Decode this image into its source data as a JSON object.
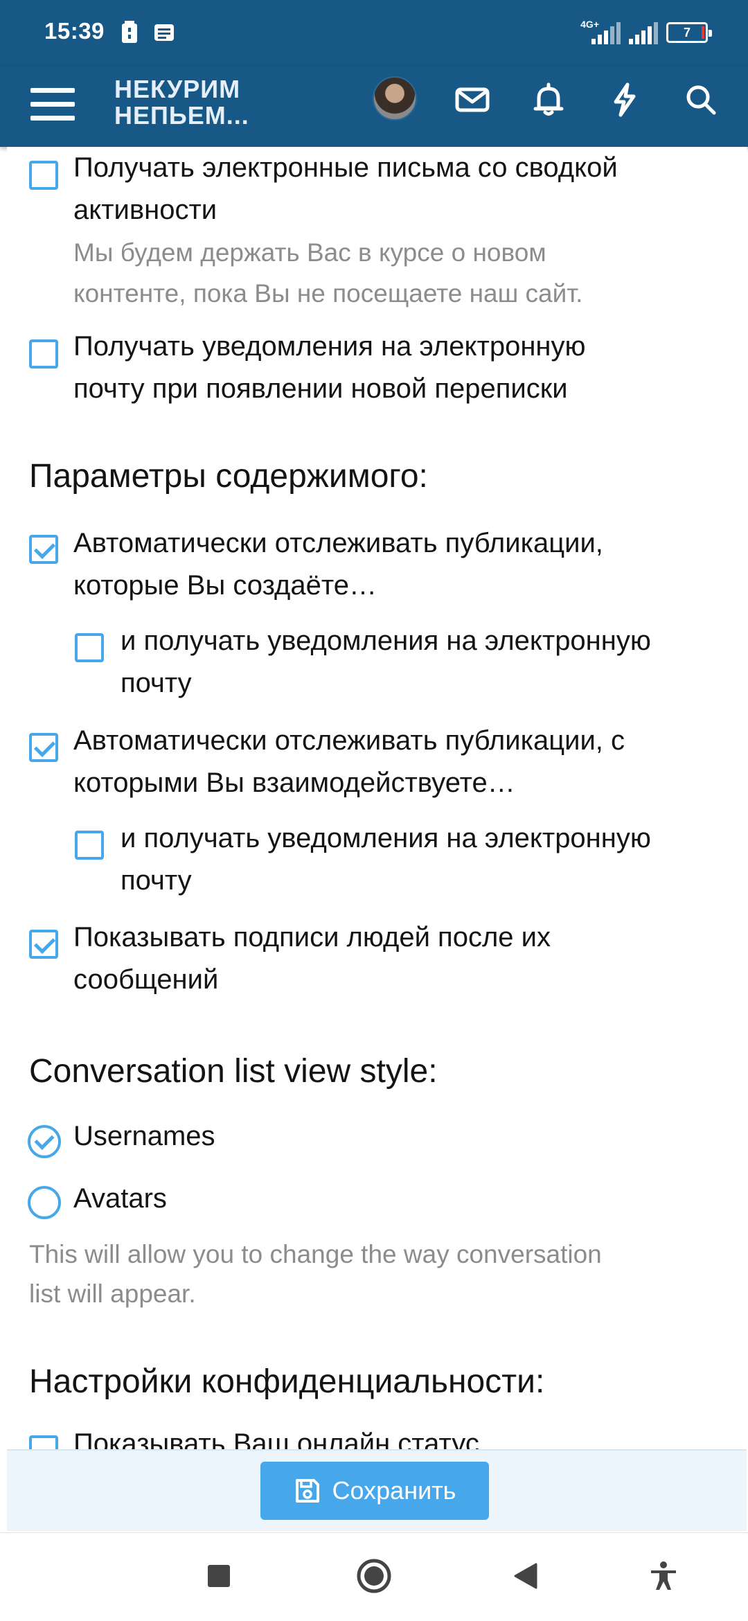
{
  "status_bar": {
    "time": "15:39",
    "network": "4G+",
    "battery": "7"
  },
  "header": {
    "logo_line1": "НЕКУРИМ",
    "logo_line2": "НЕПЬЕМ...",
    "icons": [
      "menu-icon",
      "avatar",
      "mail-icon",
      "bell-icon",
      "bolt-icon",
      "search-icon"
    ]
  },
  "options": {
    "activity_email": {
      "label_line1": "Получать электронные письма со сводкой",
      "label_line2": "активности",
      "hint_line1": "Мы будем держать Вас в курсе о новом",
      "hint_line2": "контенте, пока Вы не посещаете наш сайт.",
      "checked": false
    },
    "conversation_email": {
      "label_line1": "Получать уведомления на электронную",
      "label_line2": "почту при появлении новой переписки",
      "checked": false
    }
  },
  "content_section": {
    "heading": "Параметры содержимого:",
    "watch_created": {
      "label_line1": "Автоматически отслеживать публикации,",
      "label_line2": "которые Вы создаёте…",
      "checked": true
    },
    "watch_created_email": {
      "label_line1": "и получать уведомления на электронную",
      "label_line2": "почту",
      "checked": false
    },
    "watch_interacted": {
      "label_line1": "Автоматически отслеживать публикации, с",
      "label_line2": "которыми Вы взаимодействуете…",
      "checked": true
    },
    "watch_interacted_email": {
      "label_line1": "и получать уведомления на электронную",
      "label_line2": "почту",
      "checked": false
    },
    "show_signatures": {
      "label_line1": "Показывать подписи людей после их",
      "label_line2": "сообщений",
      "checked": true
    }
  },
  "conversation_section": {
    "heading": "Conversation list view style:",
    "options": [
      {
        "label": "Usernames",
        "selected": true
      },
      {
        "label": "Avatars",
        "selected": false
      }
    ],
    "hint_line1": "This will allow you to change the way conversation",
    "hint_line2": "list will appear."
  },
  "privacy_section": {
    "heading": "Настройки конфиденциальности:",
    "first_option_partial": "Показывать Ваш онлайн статус"
  },
  "save_button": {
    "label": "Сохранить"
  },
  "nav_bar": {
    "icons": [
      "square-icon",
      "home-circle-icon",
      "back-triangle-icon",
      "accessibility-icon"
    ]
  },
  "colors": {
    "header_bg": "#185886",
    "accent": "#47a7eb",
    "hint_text": "#8c8c8c"
  }
}
